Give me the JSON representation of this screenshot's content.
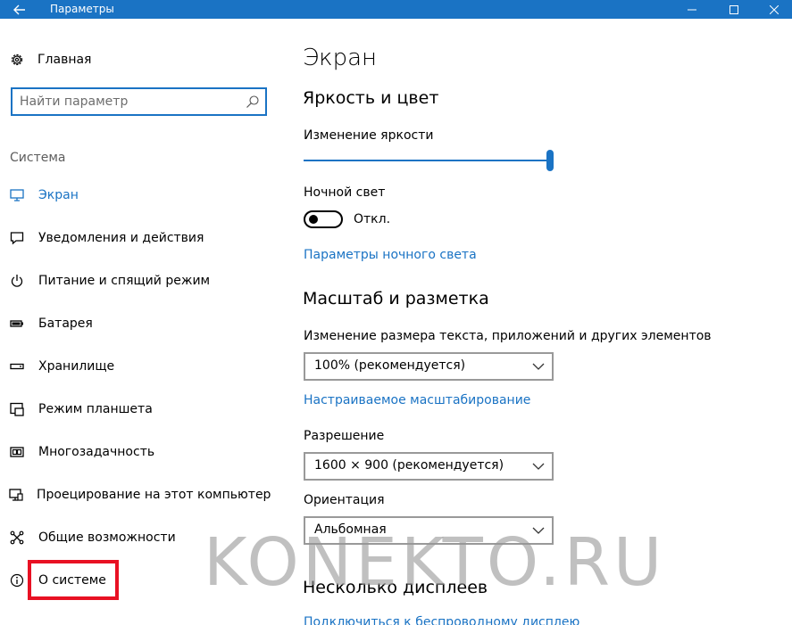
{
  "window": {
    "title": "Параметры",
    "back_icon": "arrow-left-icon"
  },
  "sidebar": {
    "home_label": "Главная",
    "search_placeholder": "Найти параметр",
    "section_title": "Система",
    "items": [
      {
        "label": "Экран",
        "icon": "monitor-icon",
        "active": true
      },
      {
        "label": "Уведомления и действия",
        "icon": "notifications-icon"
      },
      {
        "label": "Питание и спящий режим",
        "icon": "power-icon"
      },
      {
        "label": "Батарея",
        "icon": "battery-icon"
      },
      {
        "label": "Хранилище",
        "icon": "storage-icon"
      },
      {
        "label": "Режим планшета",
        "icon": "tablet-icon"
      },
      {
        "label": "Многозадачность",
        "icon": "multitasking-icon"
      },
      {
        "label": "Проецирование на этот компьютер",
        "icon": "projecting-icon"
      },
      {
        "label": "Общие возможности",
        "icon": "shared-icon"
      },
      {
        "label": "О системе",
        "icon": "info-icon"
      }
    ]
  },
  "main": {
    "title": "Экран",
    "brightness": {
      "heading": "Яркость и цвет",
      "slider_label": "Изменение яркости",
      "level": 1.0,
      "night_light_label": "Ночной свет",
      "night_light_state": "Откл.",
      "night_light_link": "Параметры ночного света"
    },
    "scale": {
      "heading": "Масштаб и разметка",
      "size_label": "Изменение размера текста, приложений и других элементов",
      "size_value": "100% (рекомендуется)",
      "custom_link": "Настраиваемое масштабирование",
      "resolution_label": "Разрешение",
      "resolution_value": "1600 × 900 (рекомендуется)",
      "orientation_label": "Ориентация",
      "orientation_value": "Альбомная"
    },
    "multi": {
      "heading": "Несколько дисплеев",
      "wireless_link": "Подключиться к беспроводному дисплею"
    },
    "watermark": "KONEKTO.RU"
  },
  "colors": {
    "accent": "#1a73c4",
    "highlight": "#e81123"
  }
}
